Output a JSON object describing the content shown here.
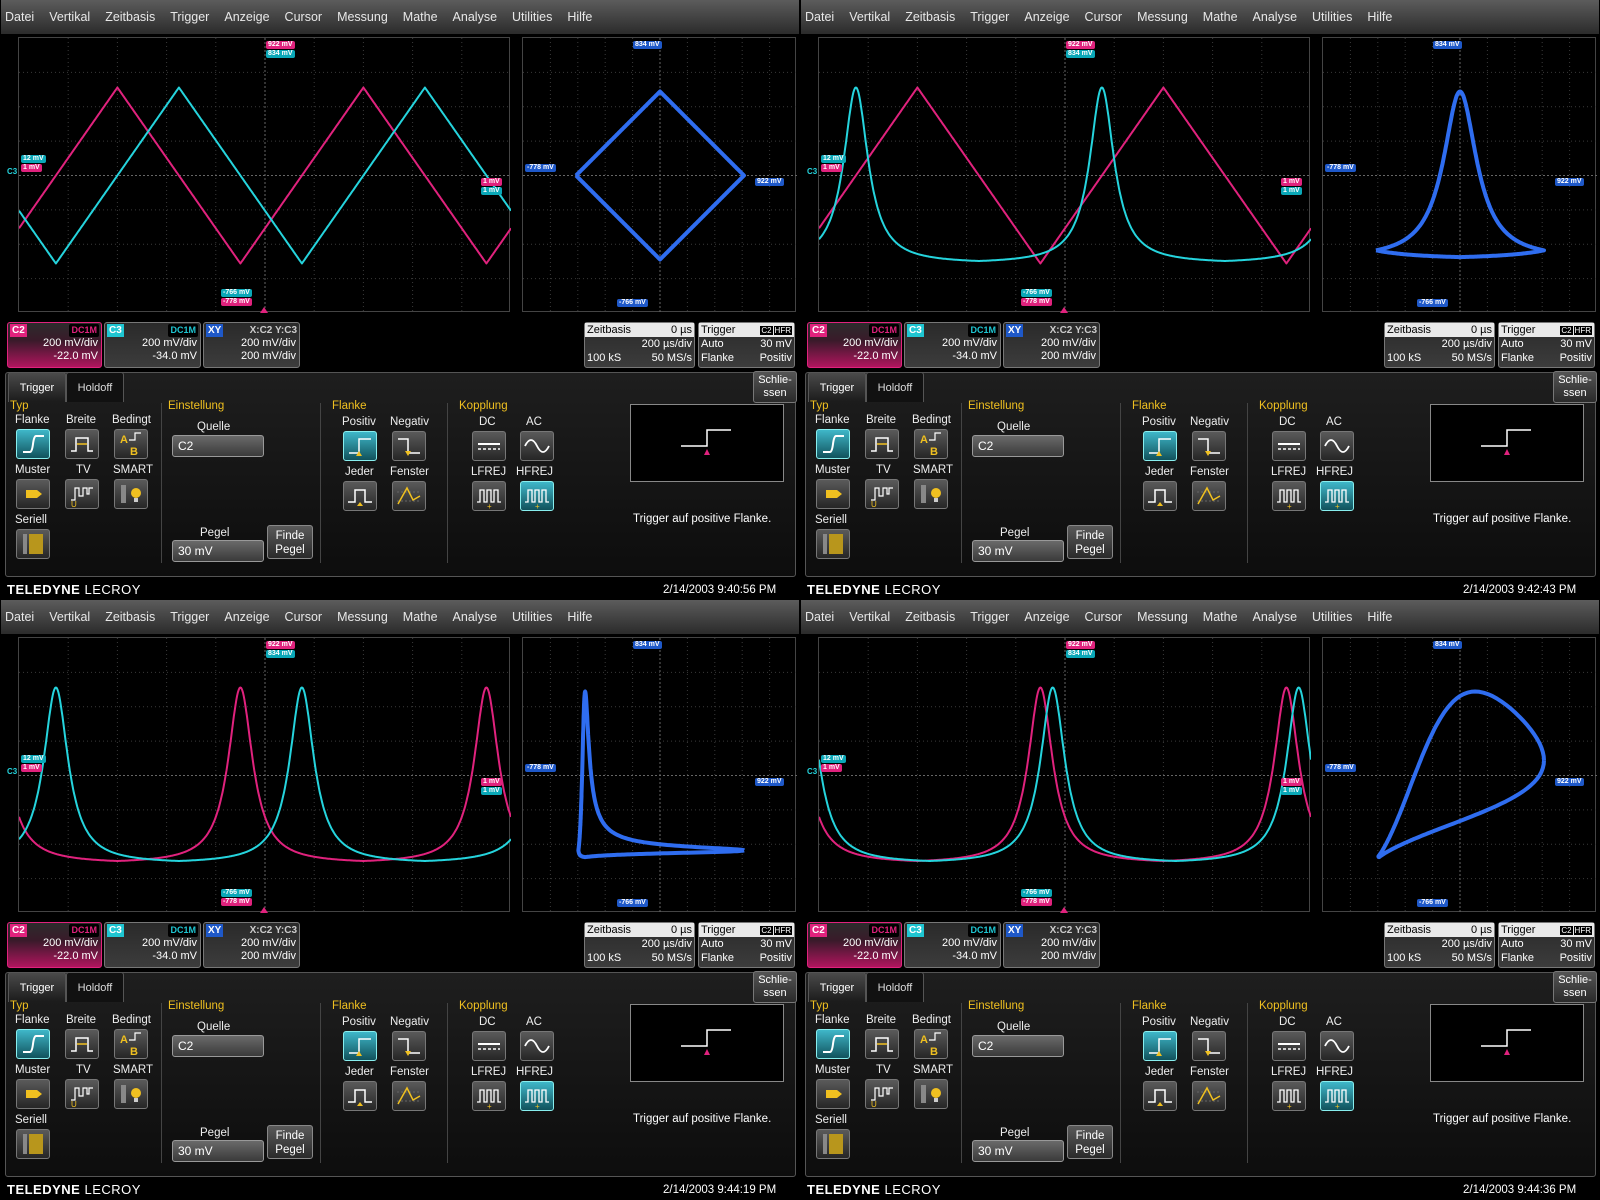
{
  "menu": [
    "Datei",
    "Vertikal",
    "Zeitbasis",
    "Trigger",
    "Anzeige",
    "Cursor",
    "Messung",
    "Mathe",
    "Analyse",
    "Utilities",
    "Hilfe"
  ],
  "colors": {
    "c2": "#e0227d",
    "c3": "#25d4dd",
    "xy": "#2f6df0"
  },
  "waveform": {
    "top_markers": [
      "922 mV",
      "834 mV"
    ],
    "left_markers": [
      "12 mV",
      "1 mV"
    ],
    "left_ground": "C3",
    "right_markers": [
      "1 mV",
      "1 mV"
    ],
    "bottom_markers": [
      "-766 mV",
      "-778 mV"
    ]
  },
  "xy_markers": {
    "top": "834 mV",
    "left": "-778 mV",
    "right": "922 mV",
    "bottom": "-766 mV"
  },
  "channels": {
    "c2": {
      "tag": "C2",
      "coupling": "DC1M",
      "vdiv": "200 mV/div",
      "offset": "-22.0 mV"
    },
    "c3": {
      "tag": "C3",
      "coupling": "DC1M",
      "vdiv": "200 mV/div",
      "offset": "-34.0 mV"
    },
    "xy": {
      "tag": "XY",
      "source": "X:C2 Y:C3",
      "line1": "200 mV/div",
      "line2": "200 mV/div"
    }
  },
  "timebase": {
    "label": "Zeitbasis",
    "delay": "0 µs",
    "tdiv": "200 µs/div",
    "samples": "100 kS",
    "rate": "50 MS/s"
  },
  "trigger_box": {
    "label": "Trigger",
    "src": "C2",
    "filter": "HFR",
    "mode": "Auto",
    "level": "30 mV",
    "type": "Flanke",
    "slope": "Positiv"
  },
  "dialog": {
    "tabs": [
      "Trigger",
      "Holdoff"
    ],
    "close": [
      "Schlie-",
      "ssen"
    ],
    "typ": {
      "title": "Typ",
      "items": [
        "Flanke",
        "Breite",
        "Bedingt",
        "Muster",
        "TV",
        "SMART",
        "Seriell"
      ]
    },
    "einstellung": {
      "title": "Einstellung",
      "quelle_label": "Quelle",
      "quelle_value": "C2",
      "pegel_label": "Pegel",
      "pegel_value": "30 mV",
      "finde": [
        "Finde",
        "Pegel"
      ]
    },
    "flanke": {
      "title": "Flanke",
      "items": [
        "Positiv",
        "Negativ",
        "Jeder",
        "Fenster"
      ]
    },
    "kopplung": {
      "title": "Kopplung",
      "items": [
        "DC",
        "AC",
        "LFREJ",
        "HFREJ"
      ]
    },
    "description": "Trigger auf positive Flanke."
  },
  "brand": {
    "bold": "TELEDYNE",
    "light": "LECROY"
  },
  "panels": [
    {
      "timestamp": "2/14/2003 9:40:56 PM",
      "ch2": "tri",
      "ch3": "tri",
      "shift": 0.25
    },
    {
      "timestamp": "2/14/2003 9:42:43 PM",
      "ch2": "tri",
      "ch3": "peak",
      "shift": 0.25
    },
    {
      "timestamp": "2/14/2003 9:44:19 PM",
      "ch2": "peak",
      "ch3": "peak",
      "shift": 0.25
    },
    {
      "timestamp": "2/14/2003 9:44:36 PM",
      "ch2": "peak",
      "ch3": "peak",
      "shift": 0.05
    }
  ]
}
